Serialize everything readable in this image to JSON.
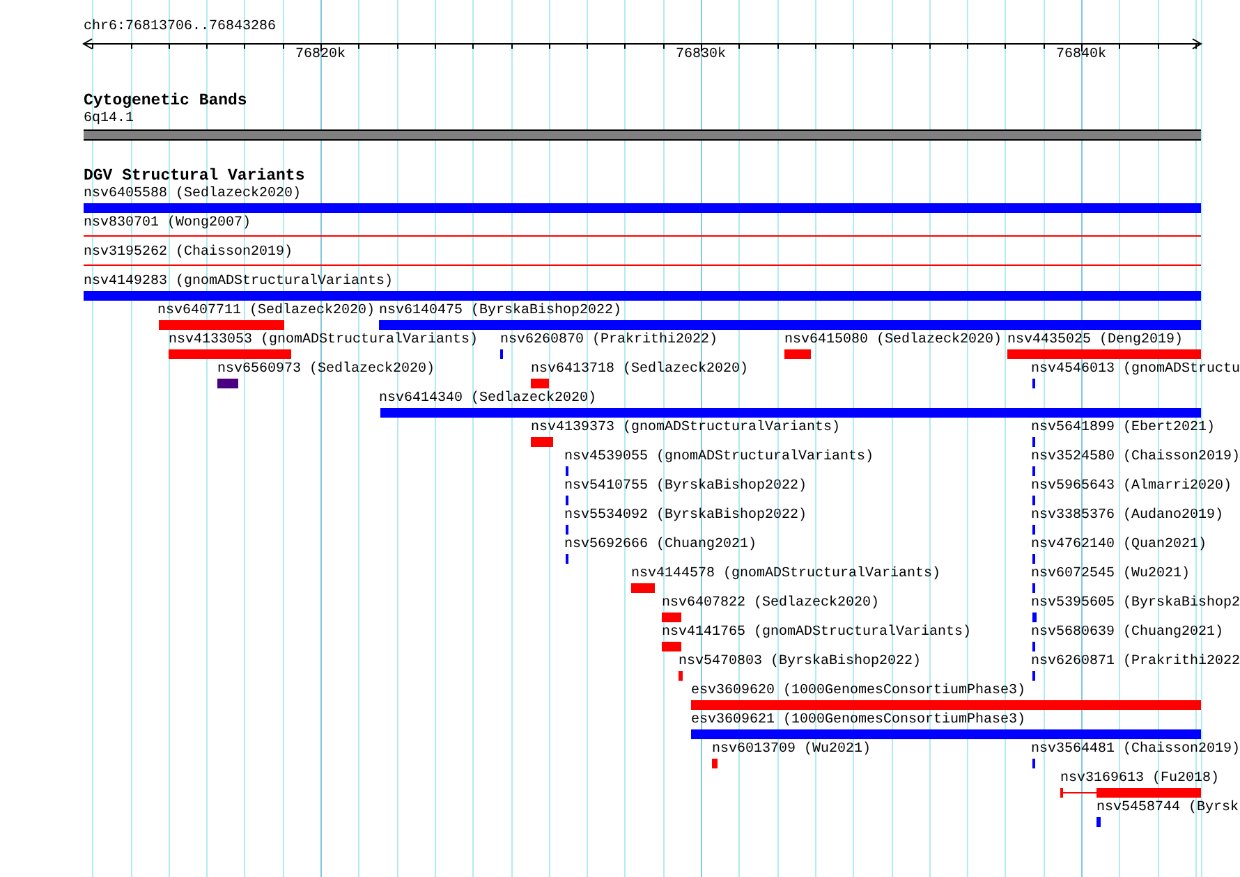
{
  "ruler": {
    "locus": "chr6:76813706..76843286",
    "ticks": [
      "76820k",
      "76830k",
      "76840k"
    ]
  },
  "cytoband_track": {
    "title": "Cytogenetic Bands",
    "band": "6q14.1"
  },
  "dgv_track": {
    "title": "DGV Structural Variants",
    "features": [
      {
        "label": "nsv6405588 (Sedlazeck2020)",
        "color": "#0000ff",
        "kind": "bar"
      },
      {
        "label": "nsv830701 (Wong2007)",
        "color": "#ff0000",
        "kind": "line"
      },
      {
        "label": "nsv3195262 (Chaisson2019)",
        "color": "#ff0000",
        "kind": "line"
      },
      {
        "label": "nsv4149283 (gnomADStructuralVariants)",
        "color": "#0000ff",
        "kind": "bar"
      },
      {
        "label": "nsv6407711 (Sedlazeck2020)",
        "color": "#ff0000",
        "kind": "bar"
      },
      {
        "label": "nsv6140475 (ByrskaBishop2022)",
        "color": "#0000ff",
        "kind": "bar"
      },
      {
        "label": "nsv4133053 (gnomADStructuralVariants)",
        "color": "#ff0000",
        "kind": "bar"
      },
      {
        "label": "nsv6260870 (Prakrithi2022)",
        "color": "#0000ff",
        "kind": "bar"
      },
      {
        "label": "nsv6415080 (Sedlazeck2020)",
        "color": "#ff0000",
        "kind": "bar"
      },
      {
        "label": "nsv4435025 (Deng2019)",
        "color": "#ff0000",
        "kind": "bar"
      },
      {
        "label": "nsv6560973 (Sedlazeck2020)",
        "color": "#4b0082",
        "kind": "bar"
      },
      {
        "label": "nsv6413718 (Sedlazeck2020)",
        "color": "#ff0000",
        "kind": "bar"
      },
      {
        "label": "nsv4546013 (gnomADStructu",
        "color": "#0000ff",
        "kind": "bar"
      },
      {
        "label": "nsv6414340 (Sedlazeck2020)",
        "color": "#0000ff",
        "kind": "bar"
      },
      {
        "label": "nsv4139373 (gnomADStructuralVariants)",
        "color": "#ff0000",
        "kind": "bar"
      },
      {
        "label": "nsv5641899 (Ebert2021)",
        "color": "#0000ff",
        "kind": "bar"
      },
      {
        "label": "nsv4539055 (gnomADStructuralVariants)",
        "color": "#0000ff",
        "kind": "bar"
      },
      {
        "label": "nsv3524580 (Chaisson2019)",
        "color": "#0000ff",
        "kind": "bar"
      },
      {
        "label": "nsv5410755 (ByrskaBishop2022)",
        "color": "#0000ff",
        "kind": "bar"
      },
      {
        "label": "nsv5965643 (Almarri2020)",
        "color": "#0000ff",
        "kind": "bar"
      },
      {
        "label": "nsv5534092 (ByrskaBishop2022)",
        "color": "#0000ff",
        "kind": "bar"
      },
      {
        "label": "nsv3385376 (Audano2019)",
        "color": "#0000ff",
        "kind": "bar"
      },
      {
        "label": "nsv5692666 (Chuang2021)",
        "color": "#0000ff",
        "kind": "bar"
      },
      {
        "label": "nsv4762140 (Quan2021)",
        "color": "#0000ff",
        "kind": "bar"
      },
      {
        "label": "nsv4144578 (gnomADStructuralVariants)",
        "color": "#ff0000",
        "kind": "bar"
      },
      {
        "label": "nsv6072545 (Wu2021)",
        "color": "#0000ff",
        "kind": "bar"
      },
      {
        "label": "nsv6407822 (Sedlazeck2020)",
        "color": "#ff0000",
        "kind": "bar"
      },
      {
        "label": "nsv5395605 (ByrskaBishop2",
        "color": "#0000ff",
        "kind": "bar"
      },
      {
        "label": "nsv4141765 (gnomADStructuralVariants)",
        "color": "#ff0000",
        "kind": "bar"
      },
      {
        "label": "nsv5680639 (Chuang2021)",
        "color": "#0000ff",
        "kind": "bar"
      },
      {
        "label": "nsv5470803 (ByrskaBishop2022)",
        "color": "#ff0000",
        "kind": "bar"
      },
      {
        "label": "nsv6260871 (Prakrithi2022",
        "color": "#0000ff",
        "kind": "bar"
      },
      {
        "label": "esv3609620 (1000GenomesConsortiumPhase3)",
        "color": "#ff0000",
        "kind": "bar"
      },
      {
        "label": "esv3609621 (1000GenomesConsortiumPhase3)",
        "color": "#0000ff",
        "kind": "bar"
      },
      {
        "label": "nsv6013709 (Wu2021)",
        "color": "#ff0000",
        "kind": "bar"
      },
      {
        "label": "nsv3564481 (Chaisson2019)",
        "color": "#0000ff",
        "kind": "bar"
      },
      {
        "label": "nsv3169613 (Fu2018)",
        "color": "#ff0000",
        "kind": "split"
      },
      {
        "label": "nsv5458744 (Byrsk",
        "color": "#0000ff",
        "kind": "bar"
      }
    ]
  }
}
